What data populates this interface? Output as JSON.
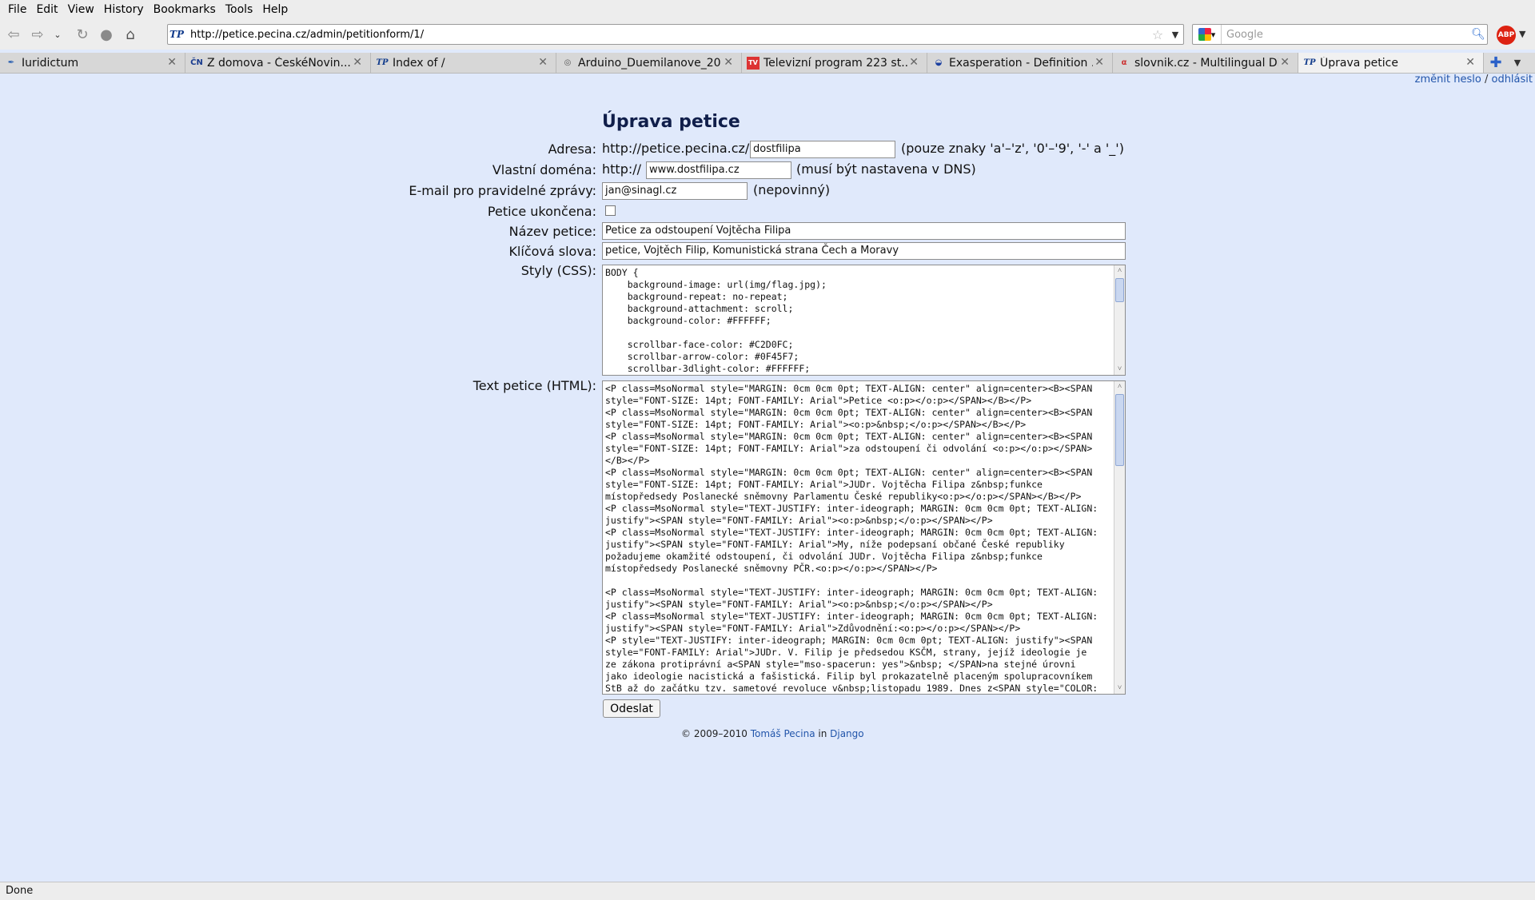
{
  "menu": [
    "File",
    "Edit",
    "View",
    "History",
    "Bookmarks",
    "Tools",
    "Help"
  ],
  "nav": {
    "url": "http://petice.pecina.cz/admin/petitionform/1/",
    "search_placeholder": "Google",
    "adblock_label": "ABP"
  },
  "tabs": [
    {
      "label": "Iuridictum",
      "icon": "iuridictum-icon",
      "fav": "✒"
    },
    {
      "label": "Z domova - ČeskéNovin...",
      "icon": "ceske-noviny-icon",
      "fav": "ČN"
    },
    {
      "label": "Index of /",
      "icon": "tp-icon",
      "fav": "TP"
    },
    {
      "label": "Arduino_Duemilanove_20...",
      "icon": "arduino-icon",
      "fav": "◎"
    },
    {
      "label": "Televizní program 223 st...",
      "icon": "tv-program-icon",
      "fav": "TV"
    },
    {
      "label": "Exasperation - Definition ...",
      "icon": "dictionary-icon",
      "fav": "◒"
    },
    {
      "label": "slovnik.cz - Multilingual Di...",
      "icon": "slovnik-icon",
      "fav": "α"
    },
    {
      "label": "Úprava petice",
      "icon": "tp-icon",
      "fav": "TP"
    }
  ],
  "user_links": {
    "change_password": "změnit heslo",
    "separator": " / ",
    "logout": "odhlásit"
  },
  "form": {
    "title": "Úprava petice",
    "address_label": "Adresa:",
    "address_prefix": "http://petice.pecina.cz/",
    "address_value": "dostfilipa",
    "address_hint": "(pouze znaky 'a'–'z', '0'–'9', '-' a '_')",
    "domain_label": "Vlastní doména:",
    "domain_prefix": "http://",
    "domain_value": "www.dostfilipa.cz",
    "domain_hint": "(musí být nastavena v DNS)",
    "email_label": "E-mail pro pravidelné zprávy:",
    "email_value": "jan@sinagl.cz",
    "email_hint": "(nepovinný)",
    "closed_label": "Petice ukončena:",
    "name_label": "Název petice:",
    "name_value": "Petice za odstoupení Vojtěcha Filipa",
    "keywords_label": "Klíčová slova:",
    "keywords_value": "petice, Vojtěch Filip, Komunistická strana Čech a Moravy",
    "css_label": "Styly (CSS):",
    "css_value": "BODY {\n    background-image: url(img/flag.jpg);\n    background-repeat: no-repeat;\n    background-attachment: scroll;\n    background-color: #FFFFFF;\n\n    scrollbar-face-color: #C2D0FC;\n    scrollbar-arrow-color: #0F45F7;\n    scrollbar-3dlight-color: #FFFFFF;",
    "html_label": "Text petice (HTML):",
    "html_value": "<P class=MsoNormal style=\"MARGIN: 0cm 0cm 0pt; TEXT-ALIGN: center\" align=center><B><SPAN\nstyle=\"FONT-SIZE: 14pt; FONT-FAMILY: Arial\">Petice <o:p></o:p></SPAN></B></P>\n<P class=MsoNormal style=\"MARGIN: 0cm 0cm 0pt; TEXT-ALIGN: center\" align=center><B><SPAN\nstyle=\"FONT-SIZE: 14pt; FONT-FAMILY: Arial\"><o:p>&nbsp;</o:p></SPAN></B></P>\n<P class=MsoNormal style=\"MARGIN: 0cm 0cm 0pt; TEXT-ALIGN: center\" align=center><B><SPAN\nstyle=\"FONT-SIZE: 14pt; FONT-FAMILY: Arial\">za odstoupení či odvolání <o:p></o:p></SPAN>\n</B></P>\n<P class=MsoNormal style=\"MARGIN: 0cm 0cm 0pt; TEXT-ALIGN: center\" align=center><B><SPAN\nstyle=\"FONT-SIZE: 14pt; FONT-FAMILY: Arial\">JUDr. Vojtěcha Filipa z&nbsp;funkce\nmístopředsedy Poslanecké sněmovny Parlamentu České republiky<o:p></o:p></SPAN></B></P>\n<P class=MsoNormal style=\"TEXT-JUSTIFY: inter-ideograph; MARGIN: 0cm 0cm 0pt; TEXT-ALIGN:\njustify\"><SPAN style=\"FONT-FAMILY: Arial\"><o:p>&nbsp;</o:p></SPAN></P>\n<P class=MsoNormal style=\"TEXT-JUSTIFY: inter-ideograph; MARGIN: 0cm 0cm 0pt; TEXT-ALIGN:\njustify\"><SPAN style=\"FONT-FAMILY: Arial\">My, níže podepsaní občané České republiky\npožadujeme okamžité odstoupení, či odvolání JUDr. Vojtěcha Filipa z&nbsp;funkce\nmístopředsedy Poslanecké sněmovny PČR.<o:p></o:p></SPAN></P>\n\n<P class=MsoNormal style=\"TEXT-JUSTIFY: inter-ideograph; MARGIN: 0cm 0cm 0pt; TEXT-ALIGN:\njustify\"><SPAN style=\"FONT-FAMILY: Arial\"><o:p>&nbsp;</o:p></SPAN></P>\n<P class=MsoNormal style=\"TEXT-JUSTIFY: inter-ideograph; MARGIN: 0cm 0cm 0pt; TEXT-ALIGN:\njustify\"><SPAN style=\"FONT-FAMILY: Arial\">Zdůvodnění:<o:p></o:p></SPAN></P>\n<P style=\"TEXT-JUSTIFY: inter-ideograph; MARGIN: 0cm 0cm 0pt; TEXT-ALIGN: justify\"><SPAN\nstyle=\"FONT-FAMILY: Arial\">JUDr. V. Filip je předsedou KSČM, strany, jejíž ideologie je\nze zákona protiprávní a<SPAN style=\"mso-spacerun: yes\">&nbsp; </SPAN>na stejné úrovni\njako ideologie nacistická a fašistická. Filip byl prokazatelně placeným spolupracovníkem\nStB až do začátku tzv. sametové revoluce v&nbsp;listopadu 1989. Dnes z<SPAN style=\"COLOR:",
    "submit_label": "Odeslat"
  },
  "footer": {
    "prefix": "© 2009–2010 ",
    "author": "Tomáš Pecina",
    "middle": " in ",
    "framework": "Django"
  },
  "status": "Done"
}
